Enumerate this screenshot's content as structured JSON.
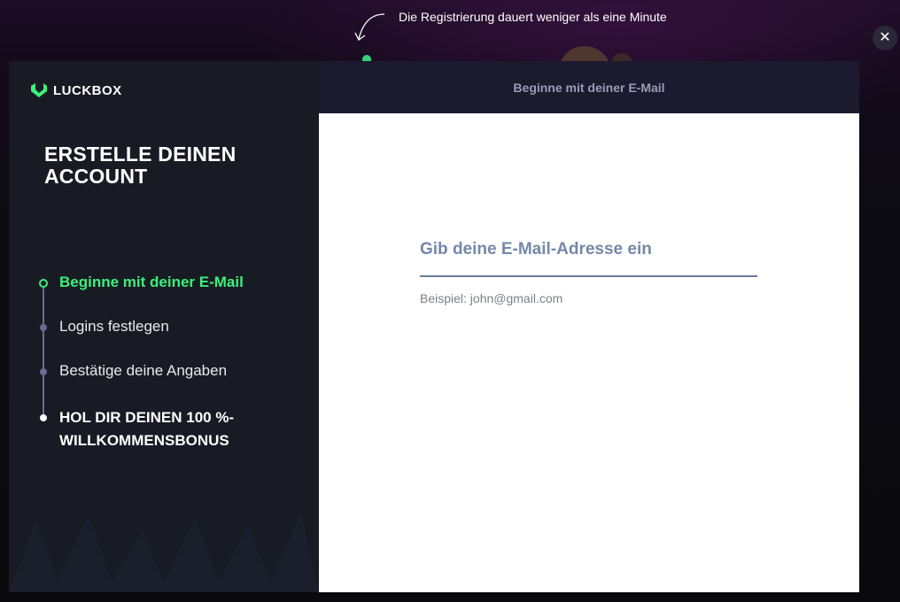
{
  "overlay": {
    "hint_text": "Die Registrierung dauert weniger als eine Minute",
    "close_label": "✕"
  },
  "brand": {
    "name": "LUCKBOX",
    "accent": "#3cf07a"
  },
  "sidebar": {
    "title": "ERSTELLE DEINEN ACCOUNT",
    "steps": [
      {
        "label": "Beginne mit deiner E-Mail",
        "state": "active"
      },
      {
        "label": "Logins festlegen",
        "state": "pending"
      },
      {
        "label": "Bestätige deine Angaben",
        "state": "pending"
      },
      {
        "label": "HOL DIR DEINEN 100 %-WILLKOMMENSBONUS",
        "state": "final"
      }
    ]
  },
  "form": {
    "header": "Beginne mit deiner E-Mail",
    "email_label": "Gib deine E-Mail-Adresse ein",
    "email_value": "",
    "email_hint": "Beispiel: john@gmail.com"
  },
  "colors": {
    "sidebar_bg": "#181b24",
    "header_bg": "#1b1a2e",
    "step_line": "#6f6894",
    "label_color": "#7588a8"
  }
}
